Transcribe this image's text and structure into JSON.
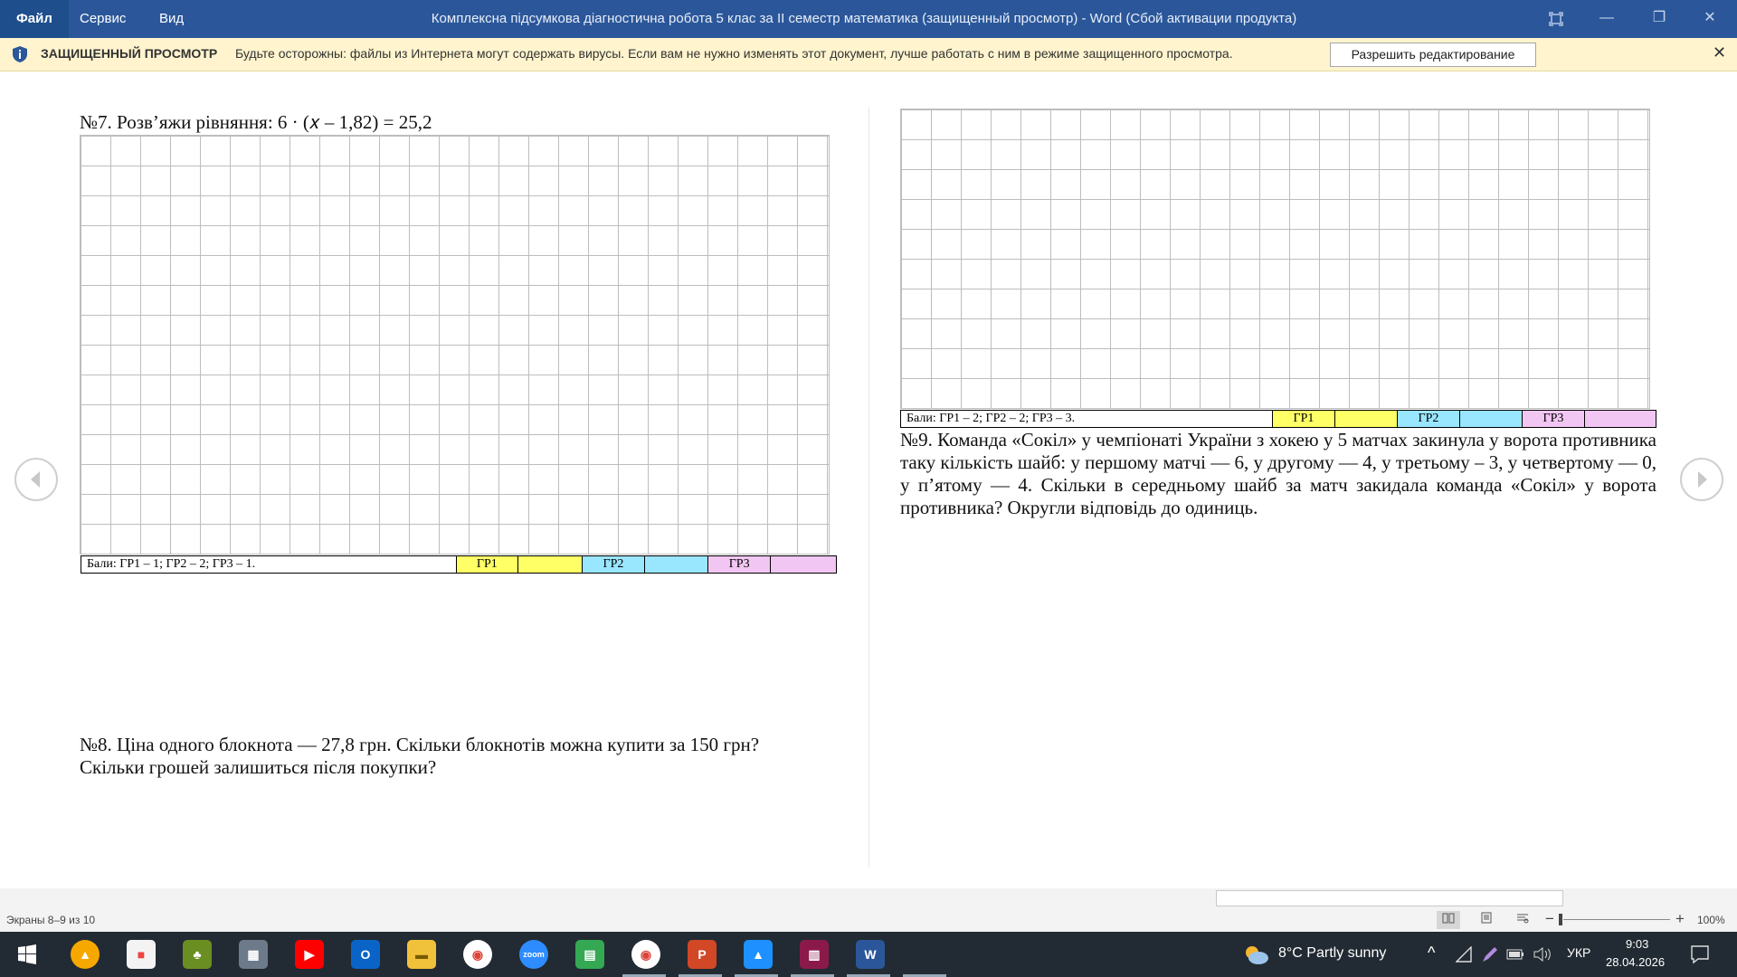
{
  "menu": {
    "file": "Файл",
    "service": "Сервис",
    "view": "Вид"
  },
  "window": {
    "title": "Комплексна підсумкова діагностична робота 5 клас за ІІ семестр математика (защищенный просмотр) - Word (Сбой активации продукта)",
    "minimize_icon": "—",
    "restore_icon": "❐",
    "close_icon": "✕"
  },
  "protected_view": {
    "label": "ЗАЩИЩЕННЫЙ ПРОСМОТР",
    "message": "Будьте осторожны: файлы из Интернета могут содержать вирусы. Если вам не нужно изменять этот документ, лучше работать с ним в режиме защищенного просмотра.",
    "enable_button": "Разрешить редактирование",
    "close_icon": "✕"
  },
  "document": {
    "task7": "№7. Розв’яжи рівняння: 6 · (𝑥 – 1,82) = 25,2",
    "score7": {
      "label": "Бали: ГР1 – 1; ГР2 – 2; ГР3 – 1.",
      "gr1": "ГР1",
      "gr2": "ГР2",
      "gr3": "ГР3"
    },
    "task8": "№8. Ціна одного блокнота — 27,8 грн. Скільки блокнотів можна купити за 150 грн? Скільки грошей залишиться після покупки?",
    "score9": {
      "label": "Бали: ГР1 – 2; ГР2 – 2; ГР3 – 3.",
      "gr1": "ГР1",
      "gr2": "ГР2",
      "gr3": "ГР3"
    },
    "task9": "№9. Команда «Сокіл» у чемпіонаті України з хокею у 5 матчах закинула у ворота противника таку кількість шайб: у першому матчі — 6, у другому — 4, у третьому – 3, у четвертому — 0, у п’ятому — 4. Скільки в середньому шайб за матч закидала команда «Сокіл» у ворота противника? Округли відповідь до одиниць."
  },
  "status_bar": {
    "pages": "Экраны 8–9 из 10",
    "zoom": "100%",
    "zoom_minus": "−",
    "zoom_plus": "+"
  },
  "taskbar": {
    "weather": "8°C  Partly sunny",
    "language": "УКР",
    "time": "9:03",
    "date": "28.04.2026",
    "apps": [
      "start-icon",
      "avast-icon",
      "store-icon",
      "game-icon",
      "calculator-icon",
      "youtube-icon",
      "outlook-icon",
      "explorer-icon",
      "chrome-icon",
      "zoom-icon",
      "sheets-icon",
      "chrome-profile-icon",
      "powerpoint-icon",
      "photos-icon",
      "winrar-icon",
      "word-icon"
    ]
  },
  "colors": {
    "titlebar": "#2b579a",
    "infobar": "#fff4ce",
    "gr1": "#ffff66",
    "gr2": "#99e6ff",
    "gr3": "#f2c6f2",
    "taskbar": "#222b33"
  }
}
